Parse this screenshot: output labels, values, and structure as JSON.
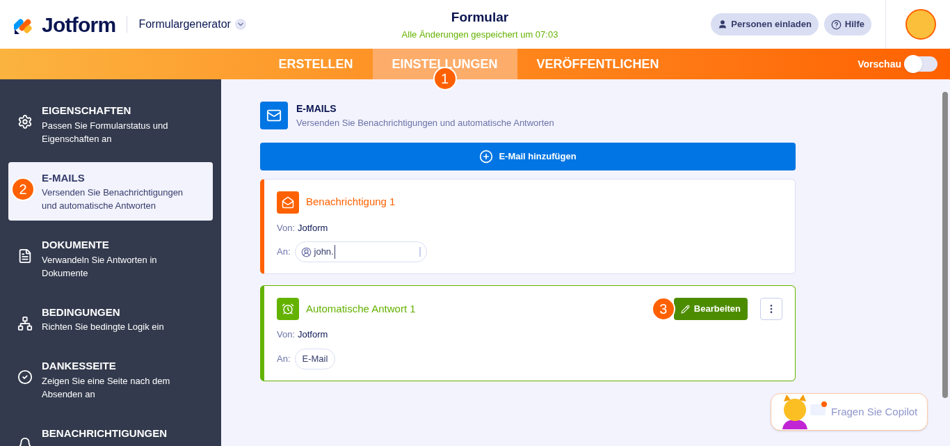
{
  "header": {
    "logo": "Jotform",
    "builder": "Formulargenerator",
    "title": "Formular",
    "saved": "Alle Änderungen gespeichert um 07:03",
    "invite": "Personen einladen",
    "help": "Hilfe"
  },
  "tabs": [
    {
      "label": "ERSTELLEN",
      "selected": false
    },
    {
      "label": "EINSTELLUNGEN",
      "selected": true,
      "marker": "1"
    },
    {
      "label": "VERÖFFENTLICHEN",
      "selected": false
    }
  ],
  "preview": {
    "label": "Vorschau",
    "on": false
  },
  "sidebar": {
    "items": [
      {
        "kind": "gear",
        "title": "EIGENSCHAFTEN",
        "description": "Passen Sie Formularstatus und Eigenschaften an",
        "selected": false
      },
      {
        "kind": "mail",
        "title": "E-MAILS",
        "description": "Versenden Sie Benachrichtigungen und automatische Antworten",
        "selected": true,
        "marker": "2"
      },
      {
        "kind": "document",
        "title": "DOKUMENTE",
        "description": "Verwandeln Sie Antworten in Dokumente",
        "selected": false
      },
      {
        "kind": "tree",
        "title": "BEDINGUNGEN",
        "description": "Richten Sie bedingte Logik ein",
        "selected": false
      },
      {
        "kind": "check",
        "title": "DANKESSEITE",
        "description": "Zeigen Sie eine Seite nach dem Absenden an",
        "selected": false
      },
      {
        "kind": "bell",
        "title": "BENACHRICHTIGUNGEN",
        "selected": false
      }
    ]
  },
  "section": {
    "title": "E-MAILS",
    "description": "Versenden Sie Benachrichtigungen und automatische Antworten"
  },
  "add_button": "E-Mail hinzufügen",
  "emails": [
    {
      "kind": "notification",
      "title": "Benachrichtigung 1",
      "from_label": "Von:",
      "from": "Jotform",
      "to_label": "An:",
      "to": {
        "kind": "input",
        "value": "john."
      }
    },
    {
      "kind": "autoresponder",
      "title": "Automatische Antwort 1",
      "from_label": "Von:",
      "from": "Jotform",
      "to_label": "An:",
      "to": {
        "kind": "chip",
        "value": "E-Mail"
      },
      "edit_button": "Bearbeiten",
      "marker": "3"
    }
  ],
  "copilot": "Fragen Sie Copilot"
}
